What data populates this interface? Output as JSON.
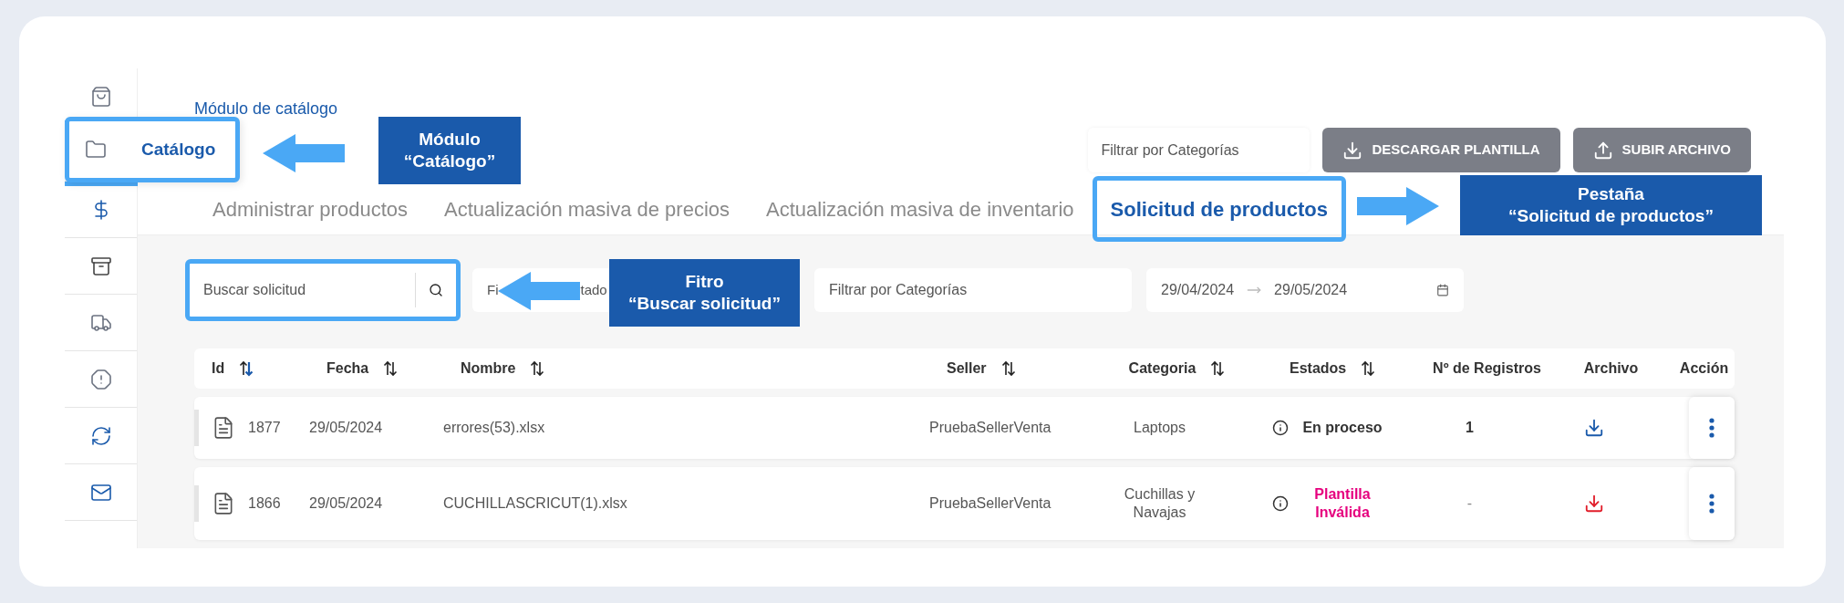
{
  "sidebar": {
    "items": [
      {
        "selected": false,
        "highlighted": false
      },
      {
        "label": "Catálogo",
        "selected": true,
        "highlighted": true
      },
      {
        "selected": false,
        "highlighted": false
      },
      {
        "selected": false,
        "highlighted": false
      },
      {
        "selected": false,
        "highlighted": false
      },
      {
        "selected": false,
        "highlighted": false
      },
      {
        "selected": false,
        "highlighted": false
      },
      {
        "selected": false,
        "highlighted": false
      }
    ]
  },
  "header": {
    "title": "Módulo de catálogo",
    "category_filter": {
      "placeholder": "Filtrar por Categorías"
    },
    "buttons": [
      {
        "label": "DESCARGAR PLANTILLA"
      },
      {
        "label": "SUBIR ARCHIVO"
      }
    ]
  },
  "tabs": [
    {
      "label": "Administrar productos",
      "selected": false,
      "highlighted": false
    },
    {
      "label": "Actualización masiva de precios",
      "selected": false,
      "highlighted": false
    },
    {
      "label": "Actualización masiva de inventario",
      "selected": false,
      "highlighted": false
    },
    {
      "label": "Solicitud de productos",
      "selected": true,
      "highlighted": true
    }
  ],
  "filters": {
    "search": {
      "placeholder": "Buscar solicitud",
      "highlighted": true
    },
    "status_filter": {
      "visible_parts": [
        "Fi",
        "tado"
      ]
    },
    "category_filter": {
      "placeholder": "Filtrar por Categorías"
    },
    "date_range": {
      "from": "29/04/2024",
      "to": "29/05/2024"
    }
  },
  "table": {
    "columns": [
      {
        "label": "Id",
        "sortable": true,
        "sorted": true
      },
      {
        "label": "Fecha",
        "sortable": true,
        "sorted": false
      },
      {
        "label": "Nombre",
        "sortable": true,
        "sorted": false
      },
      {
        "label": "Seller",
        "sortable": true,
        "sorted": false
      },
      {
        "label": "Categoria",
        "sortable": true,
        "sorted": false
      },
      {
        "label": "Estados",
        "sortable": true,
        "sorted": false
      },
      {
        "label": "Nº de Registros",
        "sortable": false
      },
      {
        "label": "Archivo",
        "sortable": false
      },
      {
        "label": "Acción",
        "sortable": false
      }
    ],
    "rows": [
      {
        "id": "1877",
        "date": "29/05/2024",
        "name": "errores(53).xlsx",
        "seller": "PruebaSellerVenta",
        "category": "Laptops",
        "status": {
          "text": "En proceso",
          "color": "#333333"
        },
        "records": "1",
        "file": {
          "color": "#1a5aab"
        }
      },
      {
        "id": "1866",
        "date": "29/05/2024",
        "name": "CUCHILLASCRICUT(1).xlsx",
        "seller": "PruebaSellerVenta",
        "category": "Cuchillas y Navajas",
        "status": {
          "text": "Plantilla Inválida",
          "color": "#e6007e"
        },
        "records": "-",
        "file": {
          "color": "#e11d2a"
        }
      }
    ]
  },
  "annotations": [
    {
      "kind": "left",
      "lines": [
        "Módulo",
        "“Catálogo”"
      ]
    },
    {
      "kind": "right",
      "lines": [
        "Pestaña",
        "“Solicitud de productos”"
      ]
    },
    {
      "kind": "left",
      "lines": [
        "Fitro",
        "“Buscar solicitud”"
      ]
    }
  ]
}
